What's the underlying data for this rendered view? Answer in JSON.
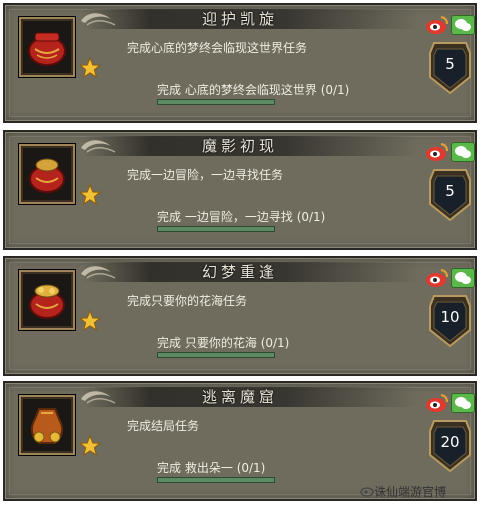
{
  "quests": [
    {
      "title": "迎护凯旋",
      "description": "完成心底的梦终会临现这世界任务",
      "progress_label": "完成",
      "progress_target": "心底的梦终会临现这世界",
      "progress_count": "(0/1)",
      "level": "5",
      "progress_fraction": 0,
      "icon": "red-pouch-icon"
    },
    {
      "title": "魔影初现",
      "description": "完成一边冒险，一边寻找任务",
      "progress_label": "完成",
      "progress_target": "一边冒险，一边寻找",
      "progress_count": "(0/1)",
      "level": "5",
      "progress_fraction": 0,
      "icon": "red-pouch-gold-icon"
    },
    {
      "title": "幻梦重逢",
      "description": "完成只要你的花海任务",
      "progress_label": "完成",
      "progress_target": "只要你的花海",
      "progress_count": "(0/1)",
      "level": "10",
      "progress_fraction": 0,
      "icon": "red-pouch-gold-icon"
    },
    {
      "title": "逃离魔窟",
      "description": "完成结局任务",
      "progress_label": "完成",
      "progress_target": "救出朵一",
      "progress_count": "(0/1)",
      "level": "20",
      "progress_fraction": 0,
      "icon": "gold-sack-icon"
    }
  ],
  "watermark": "诛仙端游官博",
  "colors": {
    "panel": "#6f6c5e",
    "progress_bar": "#8fbf8c",
    "star": "#f2c033",
    "wechat": "#5cb84a"
  }
}
